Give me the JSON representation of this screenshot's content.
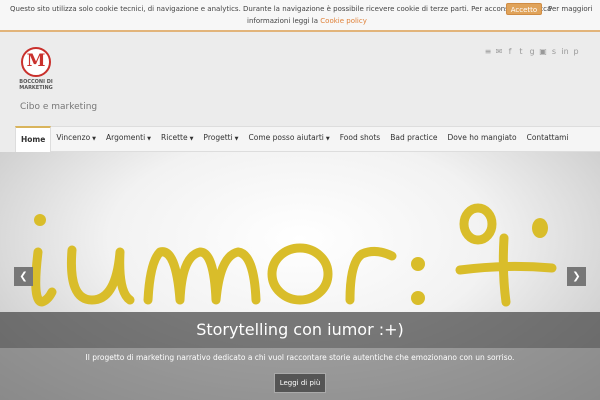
{
  "cookie": {
    "line1": "Questo sito utilizza solo cookie tecnici, di navigazione e analytics. Durante la navigazione è possibile ricevere cookie di terze parti. Per acconsentire clicca",
    "accept_label": "Accetto",
    "more_label": "Per maggiori",
    "line2_prefix": "informazioni leggi la ",
    "policy_link": "Cookie policy"
  },
  "header": {
    "logo_letter": "M",
    "logo_text": "BOCCONI DI MARKETING",
    "tagline": "Cibo e marketing",
    "social_icons": [
      "rss-icon",
      "email-icon",
      "facebook-icon",
      "twitter-icon",
      "google-plus-icon",
      "instagram-icon",
      "skype-icon",
      "linkedin-icon",
      "pinterest-icon"
    ],
    "social_glyphs": [
      "≡",
      "✉",
      "f",
      "t",
      "g",
      "▣",
      "s",
      "in",
      "p"
    ]
  },
  "nav": {
    "items": [
      {
        "label": "Home",
        "dropdown": false
      },
      {
        "label": "Vincenzo",
        "dropdown": true
      },
      {
        "label": "Argomenti",
        "dropdown": true
      },
      {
        "label": "Ricette",
        "dropdown": true
      },
      {
        "label": "Progetti",
        "dropdown": true
      },
      {
        "label": "Come posso aiutarti",
        "dropdown": true
      },
      {
        "label": "Food shots",
        "dropdown": false
      },
      {
        "label": "Bad practice",
        "dropdown": false
      },
      {
        "label": "Dove ho mangiato",
        "dropdown": false
      },
      {
        "label": "Contattami",
        "dropdown": false
      }
    ],
    "caret": "▼"
  },
  "slider": {
    "artwork_text": "iumor :+",
    "title": "Storytelling con iumor :+)",
    "description": "Il progetto di marketing narrativo dedicato a chi vuol raccontare storie autentiche che emozionano con un sorriso.",
    "read_more": "Leggi di più",
    "prev": "❮",
    "next": "❯",
    "art_color": "#d9bd2a"
  }
}
